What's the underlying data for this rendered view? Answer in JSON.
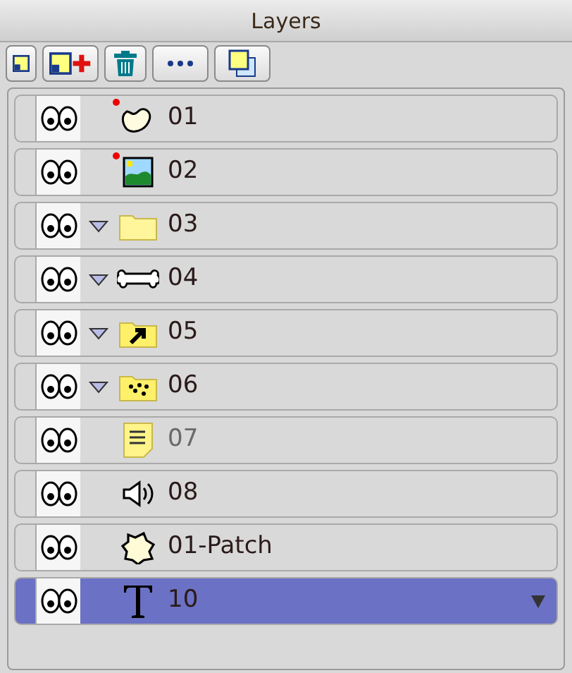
{
  "panel": {
    "title": "Layers"
  },
  "toolbar": [
    {
      "kind": "new"
    },
    {
      "kind": "new-plus"
    },
    {
      "kind": "delete"
    },
    {
      "kind": "more"
    },
    {
      "kind": "duplicate"
    }
  ],
  "layers": [
    {
      "name": "01",
      "kind": "shape",
      "visible": true,
      "flagged": true,
      "selected": false,
      "dimmed": false
    },
    {
      "name": "02",
      "kind": "image",
      "visible": true,
      "flagged": true,
      "selected": false,
      "dimmed": false
    },
    {
      "name": "03",
      "kind": "folder",
      "visible": true,
      "expanded": true,
      "flagged": false,
      "selected": false,
      "dimmed": false
    },
    {
      "name": "04",
      "kind": "bone",
      "visible": true,
      "expanded": true,
      "flagged": false,
      "selected": false,
      "dimmed": false
    },
    {
      "name": "05",
      "kind": "switch",
      "visible": true,
      "expanded": true,
      "flagged": false,
      "selected": false,
      "dimmed": false
    },
    {
      "name": "06",
      "kind": "particles",
      "visible": true,
      "expanded": true,
      "flagged": false,
      "selected": false,
      "dimmed": false
    },
    {
      "name": "07",
      "kind": "note",
      "visible": true,
      "flagged": false,
      "selected": false,
      "dimmed": true
    },
    {
      "name": "08",
      "kind": "sound",
      "visible": true,
      "flagged": false,
      "selected": false,
      "dimmed": false
    },
    {
      "name": "01-Patch",
      "kind": "patch",
      "visible": true,
      "flagged": false,
      "selected": false,
      "dimmed": false
    },
    {
      "name": "10",
      "kind": "text",
      "visible": true,
      "flagged": false,
      "selected": true,
      "dimmed": false
    }
  ]
}
